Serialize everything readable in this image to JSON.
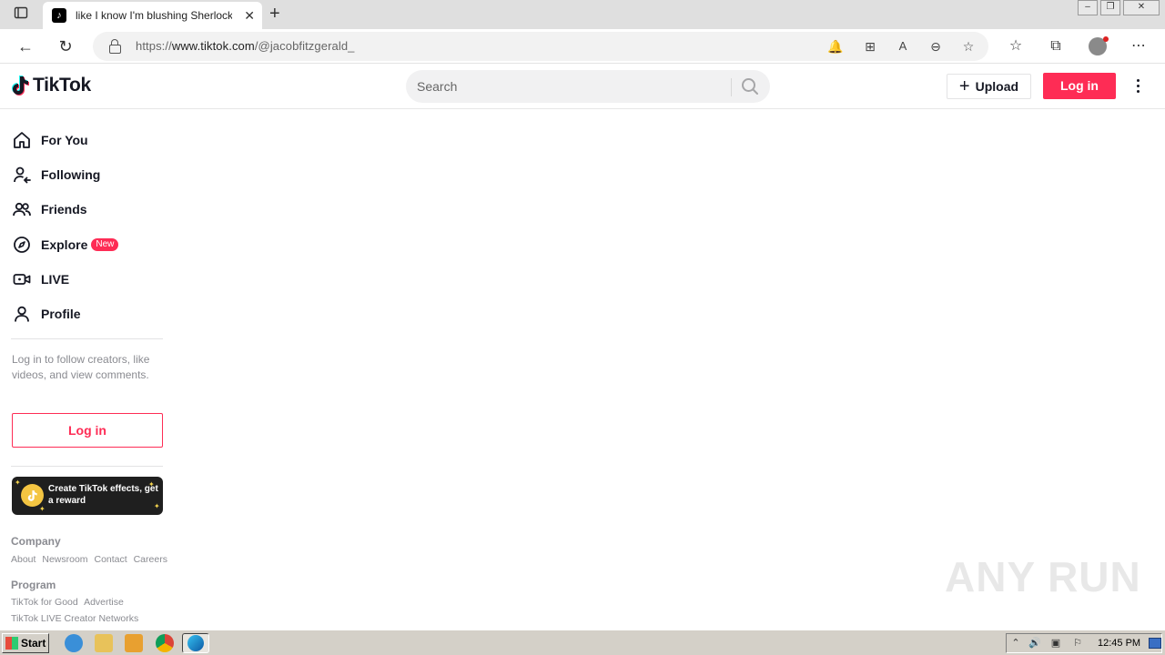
{
  "browser": {
    "tab_title": "like I know I'm blushing Sherlock",
    "url_prefix": "https://",
    "url_host": "www.tiktok.com",
    "url_path": "/@jacobfitzgerald_"
  },
  "header": {
    "logo_text": "TikTok",
    "search_placeholder": "Search",
    "upload_label": "Upload",
    "login_label": "Log in"
  },
  "sidebar": {
    "nav": [
      {
        "label": "For You"
      },
      {
        "label": "Following"
      },
      {
        "label": "Friends"
      },
      {
        "label": "Explore",
        "badge": "New"
      },
      {
        "label": "LIVE"
      },
      {
        "label": "Profile"
      }
    ],
    "login_hint": "Log in to follow creators, like videos, and view comments.",
    "login_button": "Log in",
    "effects_banner": "Create TikTok effects, get a reward",
    "footer": {
      "company_heading": "Company",
      "company_links": [
        "About",
        "Newsroom",
        "Contact",
        "Careers"
      ],
      "program_heading": "Program",
      "program_links_1": [
        "TikTok for Good",
        "Advertise"
      ],
      "program_links_2": [
        "TikTok LIVE Creator Networks"
      ]
    }
  },
  "watermark": "ANY RUN",
  "taskbar": {
    "start_label": "Start",
    "clock": "12:45 PM"
  },
  "colors": {
    "accent": "#fe2c55",
    "text": "#161823",
    "muted": "#8a8b91"
  }
}
